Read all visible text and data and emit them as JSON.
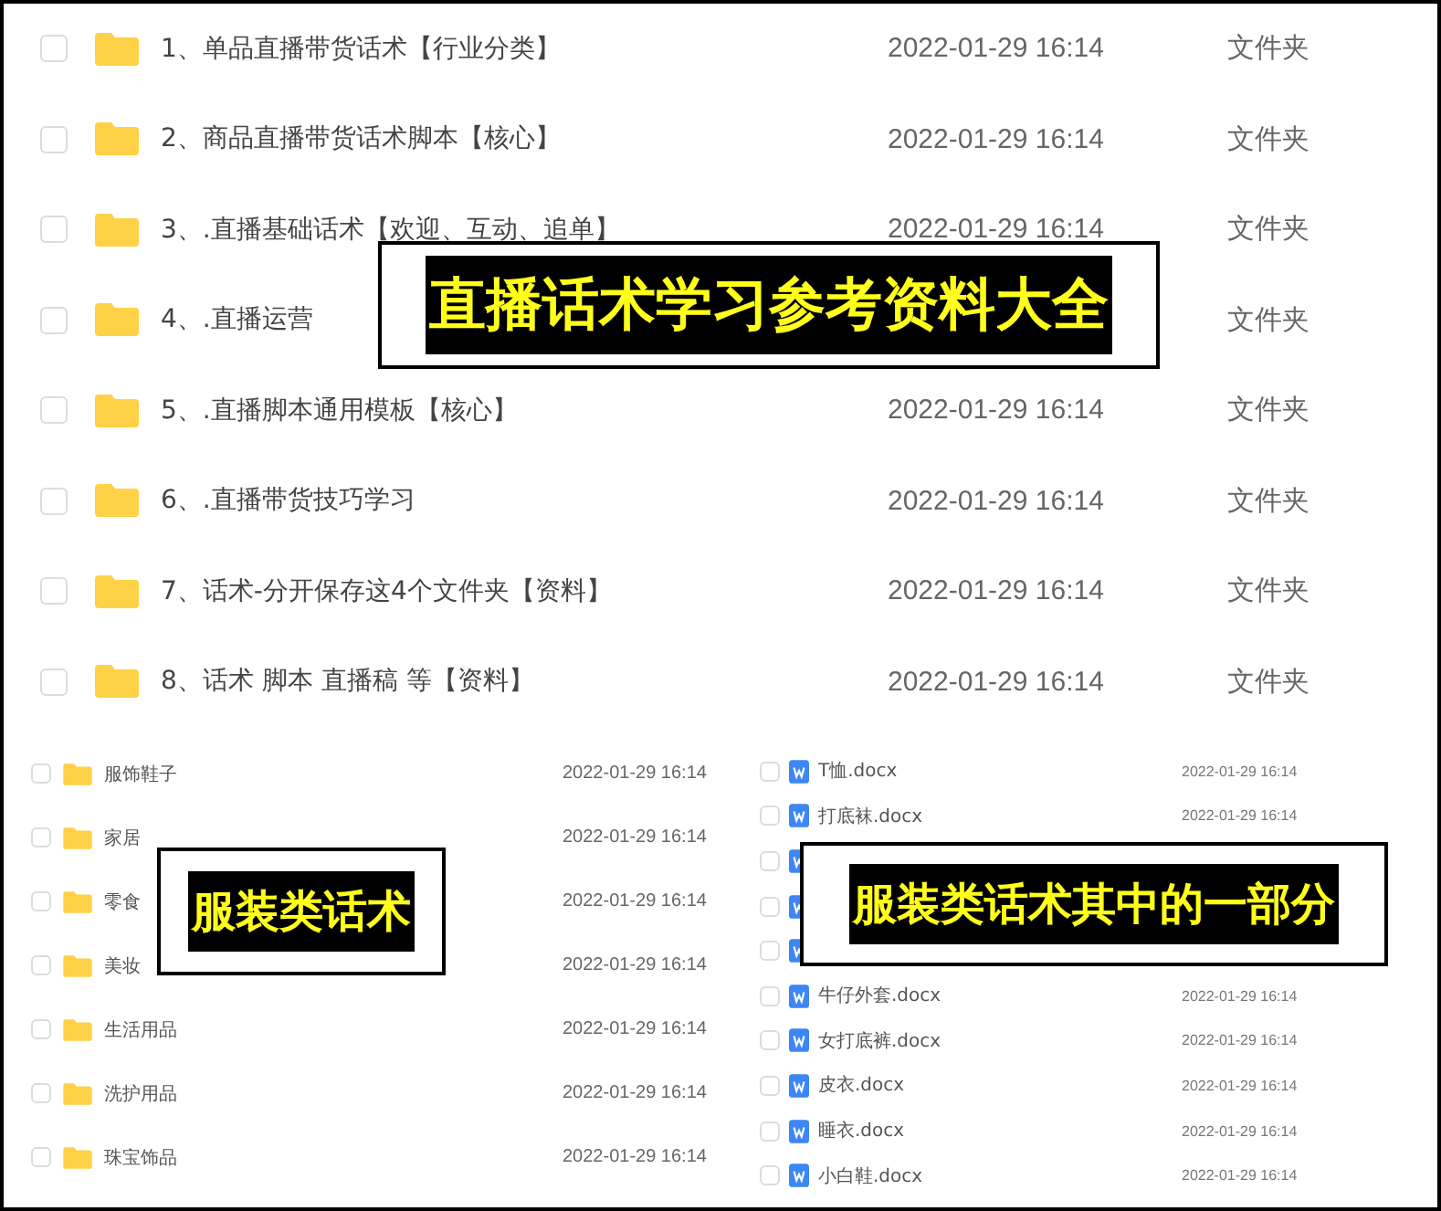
{
  "main_list": [
    {
      "name": "1、单品直播带货话术【行业分类】",
      "date": "2022-01-29 16:14",
      "type": "文件夹",
      "checked": false
    },
    {
      "name": "2、商品直播带货话术脚本【核心】",
      "date": "2022-01-29 16:14",
      "type": "文件夹",
      "checked": false
    },
    {
      "name": "3、.直播基础话术【欢迎、互动、追单】",
      "date": "2022-01-29 16:14",
      "type": "文件夹",
      "checked": false
    },
    {
      "name": "4、.直播运营",
      "type": "文件夹",
      "checked": false
    },
    {
      "name": "5、.直播脚本通用模板【核心】",
      "date": "2022-01-29 16:14",
      "type": "文件夹",
      "checked": false
    },
    {
      "name": "6、.直播带货技巧学习",
      "date": "2022-01-29 16:14",
      "type": "文件夹",
      "checked": false
    },
    {
      "name": "7、话术-分开保存这4个文件夹【资料】",
      "date": "2022-01-29 16:14",
      "type": "文件夹",
      "checked": false
    },
    {
      "name": "8、话术 脚本 直播稿 等【资料】",
      "date": "2022-01-29 16:14",
      "type": "文件夹",
      "checked": false
    }
  ],
  "main_callout": "直播话术学习参考资料大全",
  "category_list": [
    {
      "name": "服饰鞋子",
      "date": "2022-01-29 16:14",
      "checked": false
    },
    {
      "name": "家居",
      "date": "2022-01-29 16:14",
      "checked": false
    },
    {
      "name": "零食",
      "date": "2022-01-29 16:14",
      "checked": false
    },
    {
      "name": "美妆",
      "date": "2022-01-29 16:14",
      "checked": false
    },
    {
      "name": "生活用品",
      "date": "2022-01-29 16:14",
      "checked": false
    },
    {
      "name": "洗护用品",
      "date": "2022-01-29 16:14",
      "checked": false
    },
    {
      "name": "珠宝饰品",
      "date": "2022-01-29 16:14",
      "checked": false
    }
  ],
  "category_callout": "服装类话术",
  "file_list": [
    {
      "name": "T恤.docx",
      "date": "2022-01-29 16:14",
      "checked": false
    },
    {
      "name": "打底袜.docx",
      "date": "2022-01-29 16:14",
      "checked": false
    },
    {
      "checked": false
    },
    {
      "checked": false
    },
    {
      "checked": false
    },
    {
      "name": "牛仔外套.docx",
      "date": "2022-01-29 16:14",
      "checked": false
    },
    {
      "name": "女打底裤.docx",
      "date": "2022-01-29 16:14",
      "checked": false
    },
    {
      "name": "皮衣.docx",
      "date": "2022-01-29 16:14",
      "checked": false
    },
    {
      "name": "睡衣.docx",
      "date": "2022-01-29 16:14",
      "checked": false
    },
    {
      "name": "小白鞋.docx",
      "date": "2022-01-29 16:14",
      "checked": false
    }
  ],
  "file_callout": "服装类话术其中的一部分"
}
